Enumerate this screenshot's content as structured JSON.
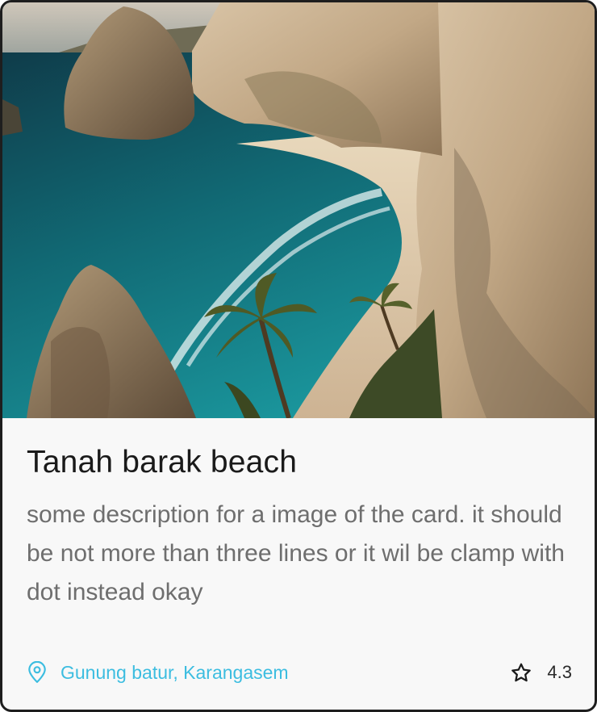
{
  "card": {
    "title": "Tanah barak beach",
    "description": "some description for a image of the card. it should be not more than three lines or it wil be clamp with dot instead okay",
    "location": "Gunung batur, Karangasem",
    "rating": "4.3",
    "icons": {
      "location": "map-pin-icon",
      "rating": "star-outline-icon"
    }
  },
  "colors": {
    "accent": "#3cbde0",
    "border": "#1e1e1e",
    "title": "#1a1a1a",
    "description": "#6e6e6e",
    "card_background": "#f8f8f8"
  }
}
